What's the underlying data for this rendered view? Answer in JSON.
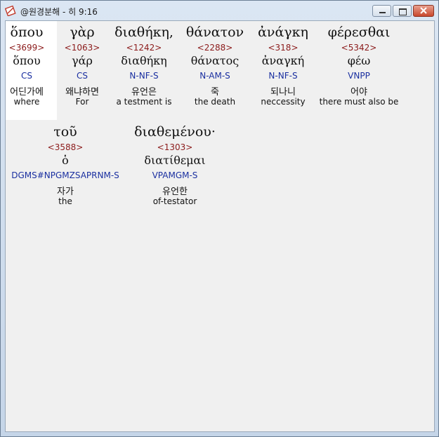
{
  "window": {
    "title": "@원경분해 - 히 9:16",
    "controls": [
      "minimize",
      "maximize",
      "close"
    ]
  },
  "words": [
    {
      "greek": "ὅπου",
      "strong": "<3699>",
      "lemma": "ὅπου",
      "morph": "CS",
      "korean": "어딘가에",
      "english": "where"
    },
    {
      "greek": "γὰρ",
      "strong": "<1063>",
      "lemma": "γάρ",
      "morph": "CS",
      "korean": "왜냐하면",
      "english": "For"
    },
    {
      "greek": "διαθήκη,",
      "strong": "<1242>",
      "lemma": "διαθήκη",
      "morph": "N-NF-S",
      "korean": "유언은",
      "english": "a testment is"
    },
    {
      "greek": "θάνατον",
      "strong": "<2288>",
      "lemma": "θάνατος",
      "morph": "N-AM-S",
      "korean": "죽",
      "english": "the death"
    },
    {
      "greek": "ἀνάγκη",
      "strong": "<318>",
      "lemma": "ἀναγκή",
      "morph": "N-NF-S",
      "korean": "되나니",
      "english": "neccessity"
    },
    {
      "greek": "φέρεσθαι",
      "strong": "<5342>",
      "lemma": "φέω",
      "morph": "VNPP",
      "korean": "어야",
      "english": "there must also be"
    },
    {
      "greek": "τοῦ",
      "strong": "<3588>",
      "lemma": "ὁ",
      "morph": "DGMS#NPGMZSAPRNM-S",
      "korean": "자가",
      "english": "the"
    },
    {
      "greek": "διαθεμένου·",
      "strong": "<1303>",
      "lemma": "διατίθεμαι",
      "morph": "VPAMGM-S",
      "korean": "유언한",
      "english": "of-testator"
    }
  ]
}
